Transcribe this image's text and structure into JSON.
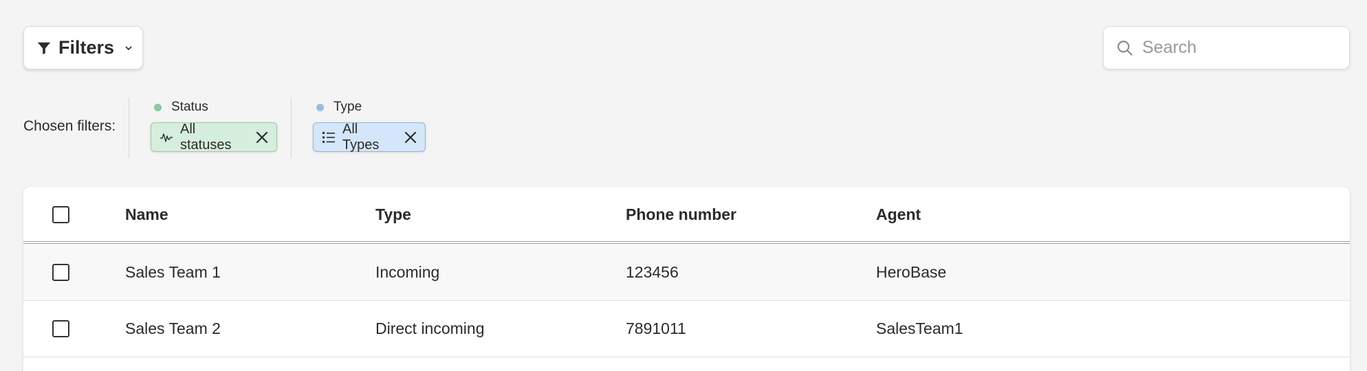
{
  "toolbar": {
    "filters_label": "Filters",
    "search_placeholder": "Search"
  },
  "chosen_filters": {
    "label": "Chosen filters:",
    "groups": [
      {
        "title": "Status",
        "dot_color": "#8fc6a2",
        "chip_label": "All statuses",
        "chip_icon": "activity-icon"
      },
      {
        "title": "Type",
        "dot_color": "#9dbbe0",
        "chip_label": "All Types",
        "chip_icon": "list-icon"
      }
    ]
  },
  "table": {
    "columns": [
      "Name",
      "Type",
      "Phone number",
      "Agent"
    ],
    "rows": [
      {
        "name": "Sales Team 1",
        "type": "Incoming",
        "phone": "123456",
        "agent": "HeroBase"
      },
      {
        "name": "Sales Team 2",
        "type": "Direct incoming",
        "phone": "7891011",
        "agent": "SalesTeam1"
      }
    ]
  },
  "colors": {
    "status_chip_bg": "#d6eedd",
    "type_chip_bg": "#d4e6f9",
    "page_bg": "#f4f4f4"
  }
}
